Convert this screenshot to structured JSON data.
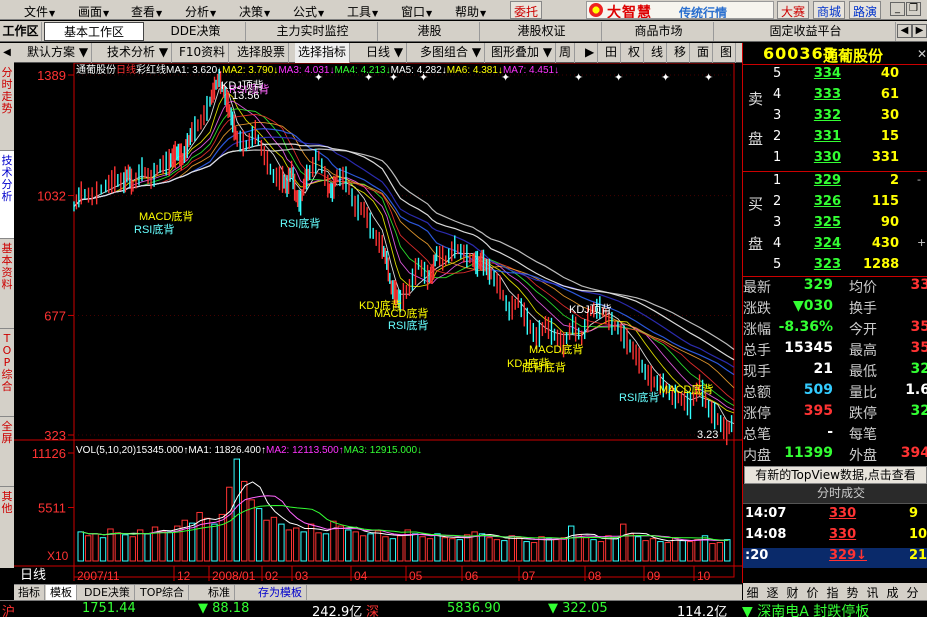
{
  "menu": {
    "items": [
      "文件",
      "画面",
      "查看",
      "分析",
      "决策",
      "公式",
      "工具",
      "窗口",
      "帮助"
    ],
    "buttons": {
      "consign": "委托",
      "contest": "大赛",
      "mall": "商城",
      "roadshow": "路演"
    },
    "brand": {
      "name": "大智慧",
      "tagline": "传统行情"
    }
  },
  "tabs": {
    "workspace_label": "工作区",
    "items": [
      "基本工作区",
      "DDE决策",
      "主力实时监控",
      "港股",
      "港股权证",
      "商品市场",
      "固定收益平台"
    ]
  },
  "chart_toolbar": {
    "items": [
      "默认方案",
      "技术分析",
      "F10资料",
      "选择股票",
      "选择指标",
      "日线",
      "多图组合",
      "图形叠加"
    ],
    "icons": [
      "周",
      "▶",
      "田",
      "权",
      "线",
      "移",
      "面",
      "图"
    ]
  },
  "side_tabs": [
    "分时走势",
    "技术分析",
    "基本资料",
    "TOP综合",
    "全屏",
    "其他"
  ],
  "stock": {
    "code": "600365",
    "name": "通葡股份"
  },
  "chart_header": {
    "name": "通葡股份",
    "period": "日线",
    "style": "彩红线",
    "ma": [
      {
        "label": "MA1: 3.620↓",
        "color": "#ffffff"
      },
      {
        "label": "MA2: 3.790↓",
        "color": "#ffff00"
      },
      {
        "label": "MA3: 4.031↓",
        "color": "#ff33ff"
      },
      {
        "label": "MA4: 4.213↓",
        "color": "#33ff33"
      },
      {
        "label": "MA5: 4.282↓",
        "color": "#ffffff"
      },
      {
        "label": "MA6: 4.381↓",
        "color": "#ffff00"
      },
      {
        "label": "MA7: 4.451↓",
        "color": "#ff33ff"
      }
    ]
  },
  "chart_data": [
    {
      "type": "line",
      "title": "通葡股份 日线",
      "yticks": [
        323,
        677,
        1032,
        1389
      ],
      "ylim": [
        323,
        1389
      ],
      "xticks": [
        "2007/11",
        "12",
        "2008/01",
        "02",
        "03",
        "04",
        "05",
        "06",
        "07",
        "08",
        "09",
        "10"
      ],
      "series": [
        {
          "name": "价格",
          "x": [
            0,
            8,
            20,
            35,
            45,
            55,
            60,
            65,
            75,
            85,
            95,
            105,
            110,
            115,
            120,
            125,
            130,
            140,
            150,
            155,
            160,
            165,
            170,
            175,
            180,
            190,
            200,
            210,
            220,
            230,
            235,
            240,
            245,
            250,
            255,
            260,
            270,
            280,
            285,
            290,
            300,
            310,
            320,
            330,
            340,
            345,
            350,
            355,
            360,
            370,
            380,
            390,
            395,
            400,
            410,
            420,
            430,
            440,
            445,
            450,
            455,
            460,
            470,
            480,
            490,
            500,
            510,
            520,
            530,
            540,
            550,
            560,
            570,
            580,
            590,
            600,
            610,
            620,
            630,
            640,
            650,
            660,
            670,
            680,
            690,
            700,
            710,
            720,
            728
          ],
          "values": [
            1000,
            1040,
            1030,
            1060,
            1080,
            1070,
            1100,
            1060,
            1110,
            1080,
            1120,
            1130,
            1150,
            1160,
            1140,
            1180,
            1220,
            1250,
            1310,
            1350,
            1380,
            1340,
            1300,
            1250,
            1200,
            1180,
            1220,
            1150,
            1090,
            1080,
            1060,
            1110,
            1030,
            1010,
            1080,
            1100,
            1150,
            1060,
            1040,
            1090,
            1080,
            1000,
            990,
            920,
            880,
            840,
            760,
            740,
            720,
            760,
            830,
            790,
            800,
            860,
            840,
            880,
            860,
            840,
            830,
            840,
            820,
            800,
            760,
            690,
            720,
            660,
            610,
            650,
            620,
            590,
            650,
            610,
            690,
            700,
            660,
            640,
            600,
            560,
            510,
            480,
            470,
            440,
            430,
            410,
            470,
            400,
            370,
            330,
            370
          ]
        }
      ],
      "annotations": [
        "RSI顶背",
        "13.56",
        "KDJ顶背",
        "MACD底背",
        "RSI底背",
        "RSI底背",
        "KDJ底背",
        "MACD底背",
        "RSI底背",
        "KDJ顶背",
        "MACD底背",
        "KDJ底背",
        "底背底背",
        "RSI底背",
        "MACD底背",
        "3.23"
      ]
    },
    {
      "type": "bar",
      "title": "VOL(5,10,20)",
      "yticks": [
        11126,
        5511
      ],
      "ylim": [
        0,
        11126
      ],
      "multiplier": "X10",
      "series": [
        {
          "name": "VOL",
          "values": [
            3000,
            2600,
            2800,
            2400,
            3300,
            2900,
            2700,
            2500,
            3200,
            2800,
            3500,
            3100,
            3000,
            3600,
            4200,
            3900,
            5000,
            4400,
            3800,
            4800,
            7600,
            10500,
            8200,
            6300,
            5400,
            4200,
            4500,
            3800,
            3200,
            3400,
            3000,
            3800,
            2900,
            2800,
            4100,
            3600,
            3200,
            3000,
            2600,
            2800,
            3100,
            2500,
            2300,
            2600,
            3200,
            2800,
            2500,
            2300,
            2800,
            2400,
            2300,
            2200,
            2700,
            3000,
            2800,
            2400,
            2200,
            2100,
            2600,
            2400,
            2000,
            1900,
            2500,
            2300,
            2200,
            2400,
            3600,
            2700,
            2400,
            2200,
            2000,
            2600,
            2300,
            3800,
            2800,
            2500,
            2100,
            2300,
            2000,
            1900,
            2400,
            2100,
            2000,
            2200,
            2600,
            1800,
            1900,
            2200
          ]
        }
      ],
      "ma_labels": [
        {
          "label": "15345.000↑",
          "color": "#ffffff"
        },
        {
          "label": "MA1: 11826.400↑",
          "color": "#ffffff"
        },
        {
          "label": "MA2: 12113.500↑",
          "color": "#ff33ff"
        },
        {
          "label": "MA3: 12915.000↓",
          "color": "#33ff33"
        }
      ]
    }
  ],
  "orderbook": {
    "sell_label": [
      "卖",
      "盘"
    ],
    "buy_label": [
      "买",
      "盘"
    ],
    "sell": [
      {
        "level": "5",
        "price": "334",
        "vol": "40",
        "chg": ""
      },
      {
        "level": "4",
        "price": "333",
        "vol": "61",
        "chg": ""
      },
      {
        "level": "3",
        "price": "332",
        "vol": "30",
        "chg": ""
      },
      {
        "level": "2",
        "price": "331",
        "vol": "15",
        "chg": ""
      },
      {
        "level": "1",
        "price": "330",
        "vol": "331",
        "chg": ""
      }
    ],
    "buy": [
      {
        "level": "1",
        "price": "329",
        "vol": "2",
        "chg": "-"
      },
      {
        "level": "2",
        "price": "326",
        "vol": "115",
        "chg": ""
      },
      {
        "level": "3",
        "price": "325",
        "vol": "90",
        "chg": ""
      },
      {
        "level": "4",
        "price": "324",
        "vol": "430",
        "chg": "+"
      },
      {
        "level": "5",
        "price": "323",
        "vol": "1288",
        "chg": ""
      }
    ]
  },
  "stats": [
    {
      "l1": "最新",
      "v1": "329",
      "c1": "#33ff33",
      "l2": "均价",
      "v2": "33",
      "c2": "#ff3333"
    },
    {
      "l1": "涨跌",
      "v1": "▼030",
      "c1": "#33ff33",
      "l2": "换手",
      "v2": "",
      "c2": "#ffffff"
    },
    {
      "l1": "涨幅",
      "v1": "-8.36%",
      "c1": "#33ff33",
      "l2": "今开",
      "v2": "35",
      "c2": "#ff3333"
    },
    {
      "l1": "总手",
      "v1": "15345",
      "c1": "#ffffff",
      "l2": "最高",
      "v2": "35",
      "c2": "#ff3333"
    },
    {
      "l1": "现手",
      "v1": "21",
      "c1": "#ffffff",
      "l2": "最低",
      "v2": "32",
      "c2": "#33ff33"
    },
    {
      "l1": "总额",
      "v1": "509",
      "c1": "#33ccff",
      "l2": "量比",
      "v2": "1.6",
      "c2": "#ffffff"
    },
    {
      "l1": "涨停",
      "v1": "395",
      "c1": "#ff3333",
      "l2": "跌停",
      "v2": "32",
      "c2": "#33ff33"
    },
    {
      "l1": "总笔",
      "v1": "-",
      "c1": "#ffffff",
      "l2": "每笔",
      "v2": "",
      "c2": "#ffffff"
    },
    {
      "l1": "内盘",
      "v1": "11399",
      "c1": "#33ff33",
      "l2": "外盘",
      "v2": "394",
      "c2": "#ff3333"
    }
  ],
  "topview": "有新的TopView数据,点击查看",
  "fenshi": {
    "header": "分时成交",
    "rows": [
      {
        "time": "14:07",
        "price": "330",
        "vol": "9"
      },
      {
        "time": "14:08",
        "price": "330",
        "vol": "10"
      },
      {
        "time": ":20",
        "price": "329↓",
        "vol": "21"
      }
    ]
  },
  "right_tabs": [
    "细",
    "逐",
    "财",
    "价",
    "指",
    "势",
    "讯",
    "成",
    "分"
  ],
  "bottom_tabs": [
    "指标",
    "模板",
    "DDE决策",
    "TOP综合",
    "标准",
    "存为模板"
  ],
  "period_label": "日线",
  "statusbar": {
    "sh_label": "沪",
    "sh_index": "1751.44",
    "sh_change": "▼ 88.18",
    "sh_amount": "242.9亿",
    "sz_label": "深",
    "sz_index": "5836.90",
    "sz_change": "▼ 322.05",
    "sz_amount": "114.2亿",
    "ticker": "▼ 深南电A 封跌停板"
  },
  "colors": {
    "up": "#ff3333",
    "down": "#33ff33",
    "accent": "#ffff00",
    "frame": "#cc0000"
  }
}
